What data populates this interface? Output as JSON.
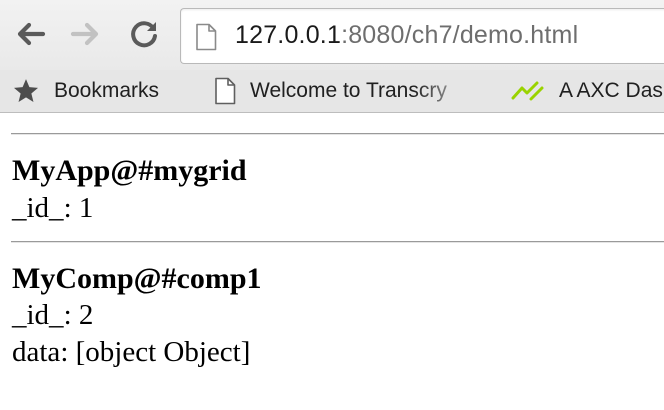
{
  "browser": {
    "url_host": "127.0.0.1",
    "url_rest": ":8080/ch7/demo.html"
  },
  "bookmarks": [
    {
      "label": "Bookmarks",
      "icon": "star-icon"
    },
    {
      "label": "Welcome to Transcry",
      "icon": "page-icon"
    },
    {
      "label": "A AXC Das",
      "icon": "axc-logo-icon"
    }
  ],
  "components": [
    {
      "name": "MyApp@#mygrid",
      "props": [
        {
          "key": "_id_",
          "value": "1"
        }
      ]
    },
    {
      "name": "MyComp@#comp1",
      "props": [
        {
          "key": "_id_",
          "value": "2"
        },
        {
          "key": "data",
          "value": "[object Object]"
        }
      ]
    }
  ],
  "colors": {
    "toolbar_bg": "#efefef",
    "bookmarks_bg": "#e6e6e6",
    "axc_green": "#9ad300",
    "url_host": "#1a1a1a",
    "url_rest": "#6e6e6e"
  }
}
